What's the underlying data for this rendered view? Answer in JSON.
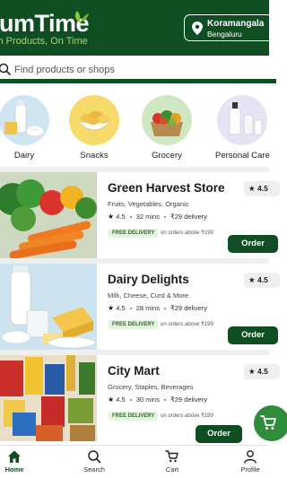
{
  "app": {
    "brand_name": "lumTime",
    "tagline": "sh Products, On Time"
  },
  "location": {
    "area": "Koramangala",
    "city": "Bengaluru"
  },
  "search": {
    "placeholder": "Find products or shops"
  },
  "categories": [
    {
      "label": "Dairy",
      "icon": "dairy-icon"
    },
    {
      "label": "Snacks",
      "icon": "snacks-icon"
    },
    {
      "label": "Grocery",
      "icon": "grocery-icon"
    },
    {
      "label": "Personal Care",
      "icon": "personal-care-icon"
    }
  ],
  "stores": [
    {
      "name": "Green Harvest Store",
      "categories": "Fruits, Vegetables, Organic",
      "rating": "4.5",
      "rating_badge": "4.5",
      "eta": "32 mins",
      "delivery_fee": "₹29 delivery",
      "free_delivery": "FREE DELIVERY",
      "order_note": "on orders above ₹199",
      "order_label": "Order"
    },
    {
      "name": "Dairy Delights",
      "categories": "Milk, Cheese, Curd & More",
      "rating": "4.5",
      "rating_badge": "4.5",
      "eta": "28 mins",
      "delivery_fee": "₹29 delivery",
      "free_delivery": "FREE DELIVERY",
      "order_note": "on orders above ₹199",
      "order_label": "Order"
    },
    {
      "name": "City Mart",
      "categories": "Grocery, Staples, Beverages",
      "rating": "4.5",
      "rating_badge": "4.5",
      "eta": "30 mins",
      "delivery_fee": "₹29 delivery",
      "free_delivery": "FREE DELIVERY",
      "order_note": "on orders above ₹199",
      "order_label": "Order"
    }
  ],
  "bottom_nav": [
    {
      "label": "Home",
      "icon": "home-icon",
      "active": true
    },
    {
      "label": "Search",
      "icon": "search-icon",
      "active": false
    },
    {
      "label": "Cart",
      "icon": "cart-icon",
      "active": false
    },
    {
      "label": "Profile",
      "icon": "profile-icon",
      "active": false
    }
  ],
  "colors": {
    "brand_green": "#0f4d22",
    "accent_green": "#2f8c3a",
    "tagline_green": "#a9d37a",
    "free_badge_bg": "#e7f4e1"
  }
}
